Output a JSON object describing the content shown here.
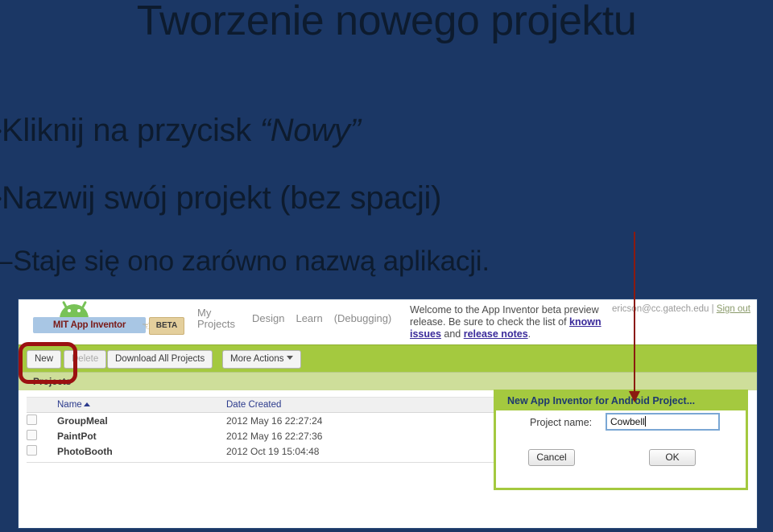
{
  "slide": {
    "title": "Tworzenie nowego projektu",
    "bullets": [
      {
        "marker": "•",
        "text_before": "Kliknij na przycisk ",
        "emphasis": "“Nowy”",
        "level": 1
      },
      {
        "marker": "•",
        "text_before": "Nazwij swój projekt (bez spacji)",
        "emphasis": "",
        "level": 1
      }
    ],
    "subbullet": {
      "marker": "–",
      "text": "Staje się ono zarówno nazwą aplikacji."
    },
    "background_color": "#1b3765",
    "text_color": "#0d1b2e"
  },
  "annotation": {
    "arrow_color": "#8b1a10",
    "highlight_color": "#9b1111"
  },
  "screenshot": {
    "header": {
      "logo_text": "MIT App Inventor",
      "beta_badge": "BETA",
      "nav": [
        {
          "label_line1": "My",
          "label_line2": "Projects"
        },
        {
          "label_line1": "Design",
          "label_line2": ""
        },
        {
          "label_line1": "Learn",
          "label_line2": ""
        },
        {
          "label_line1": "(Debugging)",
          "label_line2": ""
        }
      ],
      "welcome_part1": "Welcome to the App Inventor beta preview release. Be sure to check the list of ",
      "welcome_link1": "known issues",
      "welcome_part2": " and ",
      "welcome_link2": "release notes",
      "welcome_part3": ".",
      "account_email": "ericson@cc.gatech.edu",
      "account_separator": "|",
      "sign_out": "Sign out"
    },
    "toolbar": {
      "new_label": "New",
      "delete_label": "Delete",
      "download_label": "Download All Projects",
      "more_actions_label": "More Actions",
      "background_color": "#a4c93f"
    },
    "projects_band_label": "Projects",
    "table": {
      "columns": [
        "",
        "Name",
        "Date Created"
      ],
      "sort_column": "Name",
      "sort_direction": "ascending",
      "rows": [
        {
          "checked": false,
          "name": "GroupMeal",
          "date_created": "2012 May 16 22:27:24"
        },
        {
          "checked": false,
          "name": "PaintPot",
          "date_created": "2012 May 16 22:27:36"
        },
        {
          "checked": false,
          "name": "PhotoBooth",
          "date_created": "2012 Oct 19 15:04:48"
        }
      ]
    },
    "dialog": {
      "title": "New App Inventor for Android Project...",
      "field_label": "Project name:",
      "field_value": "Cowbell",
      "cancel_label": "Cancel",
      "ok_label": "OK"
    }
  }
}
